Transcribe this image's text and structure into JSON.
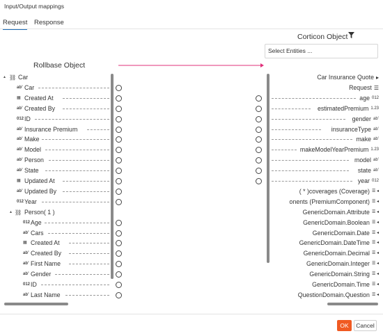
{
  "title": "Input/Output mappings",
  "tabs": [
    {
      "label": "Request",
      "active": true
    },
    {
      "label": "Response",
      "active": false
    }
  ],
  "corticon": {
    "title": "Corticon Object",
    "filter_icon": "filter-icon",
    "select_placeholder": "Select Entities ..."
  },
  "rollbase": {
    "title": "Rollbase Object"
  },
  "colors": {
    "accent": "#1e6cb7",
    "arrow": "#e0307a",
    "ok": "#f05a22"
  },
  "left_tree": [
    {
      "label": "Car",
      "icon": "hierarchy-icon",
      "glyph": "⛓",
      "expand": "▴",
      "circle": false
    },
    {
      "label": "Car",
      "icon": "text-field-icon",
      "glyph": "ab’",
      "circle": true
    },
    {
      "label": "Created At",
      "icon": "calendar-icon",
      "glyph": "▦",
      "circle": true
    },
    {
      "label": "Created By",
      "icon": "text-field-icon",
      "glyph": "ab’",
      "circle": true
    },
    {
      "label": "ID",
      "icon": "number-icon",
      "glyph": "012",
      "circle": true
    },
    {
      "label": "Insurance Premium",
      "icon": "text-field-icon",
      "glyph": "ab’",
      "circle": true
    },
    {
      "label": "Make",
      "icon": "text-field-icon",
      "glyph": "ab’",
      "circle": true
    },
    {
      "label": "Model",
      "icon": "text-field-icon",
      "glyph": "ab’",
      "circle": true
    },
    {
      "label": "Person",
      "icon": "text-field-icon",
      "glyph": "ab’",
      "circle": true
    },
    {
      "label": "State",
      "icon": "text-field-icon",
      "glyph": "ab’",
      "circle": true
    },
    {
      "label": "Updated At",
      "icon": "calendar-icon",
      "glyph": "▦",
      "circle": true
    },
    {
      "label": "Updated By",
      "icon": "text-field-icon",
      "glyph": "ab’",
      "circle": true
    },
    {
      "label": "Year",
      "icon": "number-icon",
      "glyph": "012",
      "circle": true
    },
    {
      "label": "Person( 1 )",
      "icon": "hierarchy-icon",
      "glyph": "⛓",
      "expand": "▴",
      "circle": false
    },
    {
      "label": "Age",
      "icon": "number-icon",
      "glyph": "012",
      "circle": true,
      "indent": 1
    },
    {
      "label": "Cars",
      "icon": "text-field-icon",
      "glyph": "ab’",
      "circle": true,
      "indent": 1
    },
    {
      "label": "Created At",
      "icon": "calendar-icon",
      "glyph": "▦",
      "circle": true,
      "indent": 1
    },
    {
      "label": "Created By",
      "icon": "text-field-icon",
      "glyph": "ab’",
      "circle": true,
      "indent": 1
    },
    {
      "label": "First Name",
      "icon": "text-field-icon",
      "glyph": "ab’",
      "circle": true,
      "indent": 1
    },
    {
      "label": "Gender",
      "icon": "text-field-icon",
      "glyph": "ab’",
      "circle": true,
      "indent": 1
    },
    {
      "label": "ID",
      "icon": "number-icon",
      "glyph": "012",
      "circle": true,
      "indent": 1
    },
    {
      "label": "Last Name",
      "icon": "text-field-icon",
      "glyph": "ab’",
      "circle": true,
      "indent": 1
    }
  ],
  "right_tree": [
    {
      "label": "Car Insurance Quote",
      "icon": "expand-icon",
      "glyph": "▸",
      "circle": false,
      "dashed": false
    },
    {
      "label": "Request",
      "icon": "list-icon",
      "glyph": "☰",
      "circle": false,
      "dashed": false
    },
    {
      "label": "age",
      "icon": "number-icon",
      "glyph": "012",
      "circle": true,
      "dashed": true
    },
    {
      "label": "estimatedPremium",
      "icon": "decimal-icon",
      "glyph": "1.23",
      "circle": true,
      "dashed": true
    },
    {
      "label": "gender",
      "icon": "text-field-icon",
      "glyph": "ab’",
      "circle": true,
      "dashed": true
    },
    {
      "label": "insuranceType",
      "icon": "text-field-icon",
      "glyph": "ab’",
      "circle": true,
      "dashed": true
    },
    {
      "label": "make",
      "icon": "text-field-icon",
      "glyph": "ab’",
      "circle": true,
      "dashed": true
    },
    {
      "label": "makeModelYearPremium",
      "icon": "decimal-icon",
      "glyph": "1.23",
      "circle": true,
      "dashed": true
    },
    {
      "label": "model",
      "icon": "text-field-icon",
      "glyph": "ab’",
      "circle": true,
      "dashed": true
    },
    {
      "label": "state",
      "icon": "text-field-icon",
      "glyph": "ab’",
      "circle": true,
      "dashed": true
    },
    {
      "label": "year",
      "icon": "number-icon",
      "glyph": "012",
      "circle": true,
      "dashed": true
    },
    {
      "label": "( * )coverages (Coverage)",
      "icon": "list-icon",
      "glyph": "☰ ◂",
      "circle": false,
      "dashed": false
    },
    {
      "label": "onents (PremiumComponent)",
      "icon": "list-icon",
      "glyph": "☰ ◂",
      "circle": false,
      "dashed": false
    },
    {
      "label": "GenericDomain.Attribute",
      "icon": "list-icon",
      "glyph": "☰ ◂",
      "circle": false,
      "dashed": false
    },
    {
      "label": "GenericDomain.Boolean",
      "icon": "list-icon",
      "glyph": "☰ ◂",
      "circle": false,
      "dashed": false
    },
    {
      "label": "GenericDomain.Date",
      "icon": "list-icon",
      "glyph": "☰ ◂",
      "circle": false,
      "dashed": false
    },
    {
      "label": "GenericDomain.DateTime",
      "icon": "list-icon",
      "glyph": "☰ ◂",
      "circle": false,
      "dashed": false
    },
    {
      "label": "GenericDomain.Decimal",
      "icon": "list-icon",
      "glyph": "☰ ◂",
      "circle": false,
      "dashed": false
    },
    {
      "label": "GenericDomain.Integer",
      "icon": "list-icon",
      "glyph": "☰ ◂",
      "circle": false,
      "dashed": false
    },
    {
      "label": "GenericDomain.String",
      "icon": "list-icon",
      "glyph": "☰ ◂",
      "circle": false,
      "dashed": false
    },
    {
      "label": "GenericDomain.Time",
      "icon": "list-icon",
      "glyph": "☰ ◂",
      "circle": false,
      "dashed": false
    },
    {
      "label": "QuestionDomain.Question",
      "icon": "list-icon",
      "glyph": "☰ ◂",
      "circle": false,
      "dashed": false
    }
  ],
  "buttons": {
    "ok": "OK",
    "cancel": "Cancel"
  }
}
